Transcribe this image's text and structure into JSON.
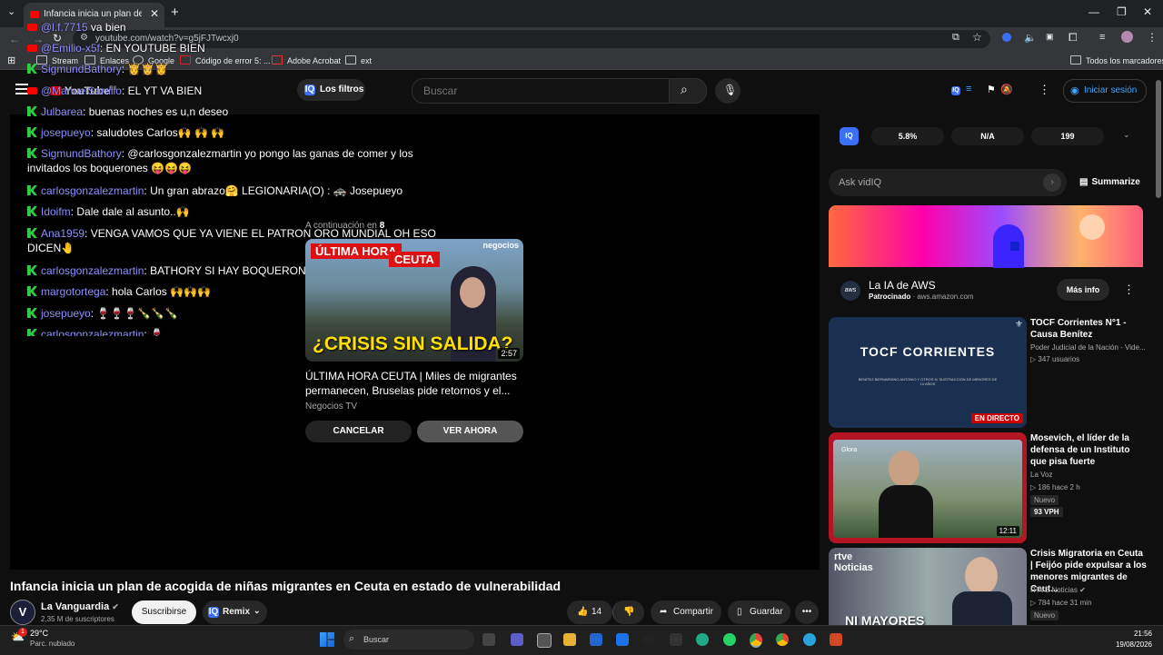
{
  "browser": {
    "tab_title": "Infancia inicia un plan de acogida de niñas migrantes en Ceuta en estado de vulnerabilidad",
    "url": "youtube.com/watch?v=g5jFJTwcxj0",
    "bookmarks": [
      "Stream",
      "Enlaces",
      "Google",
      "Código de error 5: ...",
      "Adobe Acrobat",
      "ext"
    ],
    "all_bookmarks": "Todos los marcadores"
  },
  "header": {
    "logo": "YouTube",
    "logo_region": "ES",
    "filters_label": "Los filtros",
    "search_placeholder": "Buscar",
    "signin_label": "Iniciar sesión"
  },
  "chat": [
    {
      "user": "@l.f.7715",
      "text": "va bien",
      "icon": "youtube"
    },
    {
      "user": "@Emilio-x5f",
      "text": "EN YOUTUBE BIEN",
      "icon": "youtube"
    },
    {
      "user": "SigmundBathory",
      "text": "👸👸👸",
      "icon": "kick"
    },
    {
      "user": "@ManuelSarrillo",
      "text": "EL YT VA BIEN",
      "icon": "youtube"
    },
    {
      "user": "Julbarea",
      "text": "buenas noches es u,n deseo",
      "icon": "kick"
    },
    {
      "user": "josepueyo",
      "text": "saludotes Carlos🙌 🙌 🙌",
      "icon": "kick"
    },
    {
      "user": "SigmundBathory",
      "text": "@carlosgonzalezmartin yo pongo las ganas de comer y los invitados los boquerones 😝😝😝",
      "icon": "kick"
    },
    {
      "user": "carlosgonzalezmartin",
      "text": "Un gran abrazo🤗 LEGIONARIA(O) : 🚓 Josepueyo",
      "icon": "kick"
    },
    {
      "user": "Idoifm",
      "text": "Dale dale al asunto..🙌",
      "icon": "kick"
    },
    {
      "user": "Ana1959",
      "text": "VENGA VAMOS QUE YA VIENE EL PATRON ORO MUNDIAL OH ESO DICEN🤚",
      "icon": "kick"
    },
    {
      "user": "carlosgonzalezmartin",
      "text": "BATHORY SI HAY BOQUERONES VOY",
      "icon": "kick"
    },
    {
      "user": "margotortega",
      "text": "hola Carlos 🙌🙌🙌",
      "icon": "kick"
    },
    {
      "user": "josepueyo",
      "text": "🍷🍷🍷🍾🍾🍾",
      "icon": "kick"
    },
    {
      "user": "carlosgonzalezmartin",
      "text": "🍷",
      "icon": "kick"
    }
  ],
  "up_next": {
    "prefix": "A continuación en",
    "countdown": "8",
    "thumb_badge1": "ÚLTIMA HORA",
    "thumb_badge2": "CEUTA",
    "thumb_brand": "negocios",
    "thumb_headline": "¿CRISIS SIN SALIDA?",
    "duration": "2:57",
    "title": "ÚLTIMA HORA CEUTA | Miles de migrantes permanecen, Bruselas pide retornos y el...",
    "channel": "Negocios TV",
    "cancel_label": "CANCELAR",
    "watch_label": "VER AHORA"
  },
  "video": {
    "title": "Infancia inicia un plan de acogida de niñas migrantes en Ceuta en estado de vulnerabilidad",
    "channel_initial": "V",
    "channel": "La Vanguardia",
    "subscribers": "2,35 M de suscriptores",
    "subscribe_label": "Suscribirse",
    "remix_label": "Remix",
    "likes": "14",
    "share_label": "Compartir",
    "save_label": "Guardar"
  },
  "vidiq": {
    "stats": [
      "5.8%",
      "N/A",
      "199"
    ],
    "ask_placeholder": "Ask vidIQ",
    "summarize_label": "Summarize"
  },
  "ad": {
    "title": "La IA de AWS",
    "sponsored": "Patrocinado",
    "domain": "aws.amazon.com",
    "info_label": "Más info",
    "logo_text": "aws"
  },
  "recommendations": [
    {
      "title": "TOCF Corrientes N°1 - Causa Benítez",
      "channel": "Poder Judicial de la Nación - Vide...",
      "meta": "▷ 347 usuarios",
      "thumb_text": "TOCF CORRIENTES",
      "thumb_sub": "BENÍTEZ BERNARDINO ANTONIO Y OTROS S/ SUSTRACCIÓN DE MENORES DE 10 AÑOS",
      "live_badge": "EN DIRECTO"
    },
    {
      "title": "Mosevich, el líder de la defensa de un Instituto que pisa fuerte",
      "channel": "La Voz",
      "meta": "▷ 186  hace 2 h",
      "badge": "Nuevo",
      "vph": "93 VPH",
      "duration": "12:11",
      "thumb_brand": "Glora"
    },
    {
      "title": "Crisis Migratoria en Ceuta | Feijóo pide expulsar a los menores migrantes de Ceut...",
      "channel": "RTVE Noticias",
      "meta": "▷ 784  hace 31 min",
      "badge": "Nuevo",
      "thumb_brand": "rtve Noticias",
      "thumb_text": "NI MAYORES"
    }
  ],
  "taskbar": {
    "notif_count": "1",
    "temp": "29°C",
    "weather": "Parc. nublado",
    "search": "Buscar",
    "time": "21:56",
    "date": "19/08/2026"
  },
  "colors": {
    "brand_red": "#ff0000",
    "accent_blue": "#3ea6ff",
    "kick_green": "#2ecc40",
    "vidiq_blue": "#3b6ff5"
  }
}
